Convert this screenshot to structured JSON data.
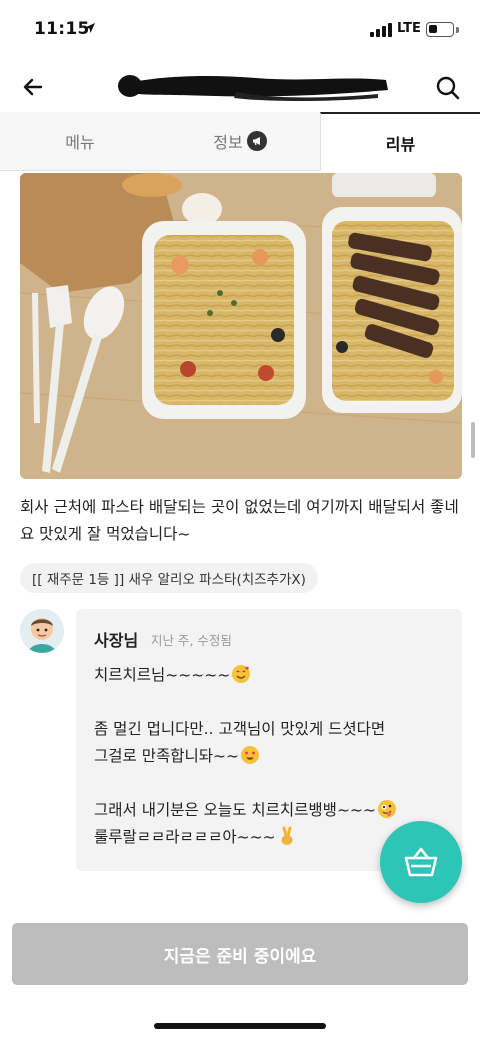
{
  "status_bar": {
    "time": "11:15",
    "network": "LTE",
    "battery_level": 0.4
  },
  "header": {
    "title": ""
  },
  "tabs": [
    {
      "label": "메뉴"
    },
    {
      "label": "정보"
    },
    {
      "label": "리뷰"
    }
  ],
  "review": {
    "text": "회사 근처에 파스타 배달되는 곳이 없었는데 여기까지 배달되서 좋네요 맛있게 잘 먹었습니다~",
    "order_tag": "[[ 재주문 1등 ]] 새우 알리오 파스타(치즈추가X)"
  },
  "owner_reply": {
    "name": "사장님",
    "meta": "지난 주, 수정됨",
    "lines": [
      "치르치르님~~~~~",
      "좀 멀긴 멉니다만.. 고객님이 맛있게 드셧다면",
      "그걸로 만족합니돠~~",
      "그래서 내기분은 오늘도 치르치르뱅뱅~~~",
      "룰루랄ㄹㄹ라ㄹㄹㄹ아~~~"
    ]
  },
  "bottom_button": {
    "label": "지금은 준비 중이에요"
  },
  "colors": {
    "accent": "#2ec4b6",
    "disabled_button": "#bdbdbd"
  }
}
